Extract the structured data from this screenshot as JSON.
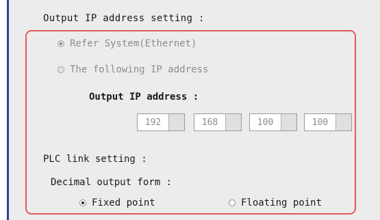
{
  "ip_section": {
    "title": "Output IP address setting :",
    "options": [
      {
        "label": "Refer System(Ethernet)",
        "selected": true,
        "enabled": false
      },
      {
        "label": "The following IP address",
        "selected": false,
        "enabled": false
      }
    ],
    "ip_label": "Output IP address :",
    "octets": [
      "192",
      "168",
      "100",
      "100"
    ]
  },
  "plc_section": {
    "title": "PLC link setting :",
    "decimal_label": "Decimal output form :",
    "options": [
      {
        "label": "Fixed point",
        "selected": true
      },
      {
        "label": "Floating point",
        "selected": false
      }
    ]
  },
  "colors": {
    "highlight": "#e2585d",
    "panel": "#ececec",
    "edge": "#2f3f8f"
  }
}
